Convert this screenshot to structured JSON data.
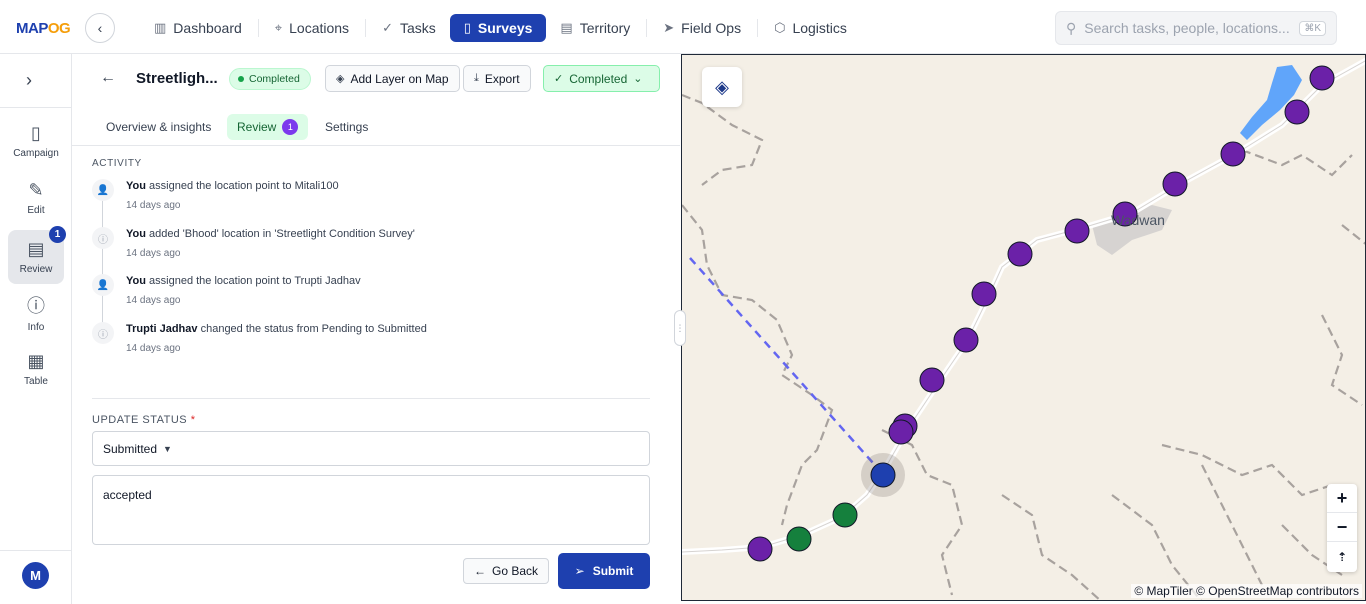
{
  "app": {
    "logo_main": "MAP",
    "logo_accent": "OG"
  },
  "nav": {
    "items": [
      {
        "label": "Dashboard",
        "icon": "bar-chart-icon"
      },
      {
        "label": "Locations",
        "icon": "map-pin-icon"
      },
      {
        "label": "Tasks",
        "icon": "check-icon"
      },
      {
        "label": "Surveys",
        "icon": "clipboard-icon",
        "active": true
      },
      {
        "label": "Territory",
        "icon": "map-icon"
      },
      {
        "label": "Field Ops",
        "icon": "send-icon"
      },
      {
        "label": "Logistics",
        "icon": "box-icon"
      }
    ],
    "search_placeholder": "Search tasks, people, locations...",
    "search_shortcut": "⌘K"
  },
  "rail": {
    "items": [
      {
        "label": "Campaign",
        "icon": "clipboard-icon"
      },
      {
        "label": "Edit",
        "icon": "edit-icon"
      },
      {
        "label": "Review",
        "icon": "document-icon",
        "badge": "1",
        "active": true
      },
      {
        "label": "Info",
        "icon": "info-icon"
      },
      {
        "label": "Table",
        "icon": "grid-icon"
      }
    ],
    "avatar": "M"
  },
  "header": {
    "title": "Streetligh...",
    "status_pill": "Completed",
    "add_layer": "Add Layer on Map",
    "export": "Export",
    "status_button": "Completed"
  },
  "tabs": [
    {
      "label": "Overview & insights"
    },
    {
      "label": "Review",
      "count": "1",
      "active": true
    },
    {
      "label": "Settings"
    }
  ],
  "activity": {
    "label": "ACTIVITY",
    "items": [
      {
        "actor": "You",
        "text": " assigned the location point to Mitali100",
        "time": "14 days ago",
        "icon": "user-icon"
      },
      {
        "actor": "You",
        "text": " added 'Bhood' location in 'Streetlight Condition Survey'",
        "time": "14 days ago",
        "icon": "info-icon"
      },
      {
        "actor": "You",
        "text": " assigned the location point to Trupti Jadhav",
        "time": "14 days ago",
        "icon": "user-icon"
      },
      {
        "actor": "Trupti Jadhav",
        "text": " changed the status from Pending to Submitted",
        "time": "14 days ago",
        "icon": "info-icon"
      }
    ]
  },
  "update_status": {
    "label": "UPDATE STATUS",
    "required": "*",
    "selected": "Submitted",
    "comment": "accepted",
    "go_back": "Go Back",
    "submit": "Submit"
  },
  "map": {
    "town_label": "Wadwan",
    "attribution": "© MapTiler © OpenStreetMap contributors",
    "colors": {
      "purple": "#6b21a8",
      "green": "#15803d",
      "blue": "#1e40af",
      "water": "#60a5fa",
      "boundary": "#a8a29e",
      "route": "#6366f1"
    }
  }
}
